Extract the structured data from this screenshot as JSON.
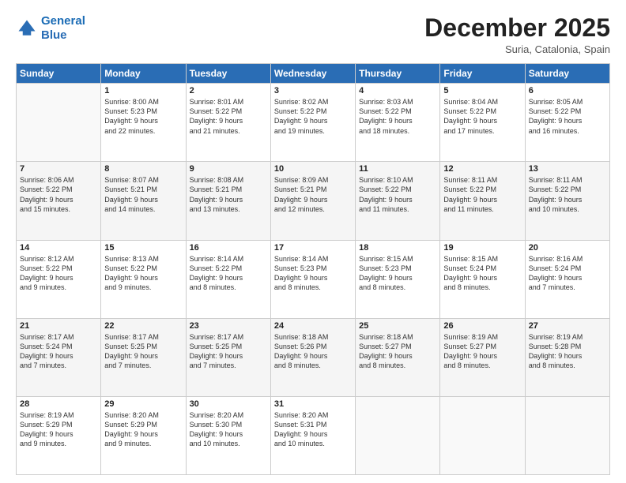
{
  "logo": {
    "line1": "General",
    "line2": "Blue"
  },
  "title": "December 2025",
  "location": "Suria, Catalonia, Spain",
  "weekdays": [
    "Sunday",
    "Monday",
    "Tuesday",
    "Wednesday",
    "Thursday",
    "Friday",
    "Saturday"
  ],
  "weeks": [
    [
      {
        "day": "",
        "info": ""
      },
      {
        "day": "1",
        "info": "Sunrise: 8:00 AM\nSunset: 5:23 PM\nDaylight: 9 hours\nand 22 minutes."
      },
      {
        "day": "2",
        "info": "Sunrise: 8:01 AM\nSunset: 5:22 PM\nDaylight: 9 hours\nand 21 minutes."
      },
      {
        "day": "3",
        "info": "Sunrise: 8:02 AM\nSunset: 5:22 PM\nDaylight: 9 hours\nand 19 minutes."
      },
      {
        "day": "4",
        "info": "Sunrise: 8:03 AM\nSunset: 5:22 PM\nDaylight: 9 hours\nand 18 minutes."
      },
      {
        "day": "5",
        "info": "Sunrise: 8:04 AM\nSunset: 5:22 PM\nDaylight: 9 hours\nand 17 minutes."
      },
      {
        "day": "6",
        "info": "Sunrise: 8:05 AM\nSunset: 5:22 PM\nDaylight: 9 hours\nand 16 minutes."
      }
    ],
    [
      {
        "day": "7",
        "info": "Sunrise: 8:06 AM\nSunset: 5:22 PM\nDaylight: 9 hours\nand 15 minutes."
      },
      {
        "day": "8",
        "info": "Sunrise: 8:07 AM\nSunset: 5:21 PM\nDaylight: 9 hours\nand 14 minutes."
      },
      {
        "day": "9",
        "info": "Sunrise: 8:08 AM\nSunset: 5:21 PM\nDaylight: 9 hours\nand 13 minutes."
      },
      {
        "day": "10",
        "info": "Sunrise: 8:09 AM\nSunset: 5:21 PM\nDaylight: 9 hours\nand 12 minutes."
      },
      {
        "day": "11",
        "info": "Sunrise: 8:10 AM\nSunset: 5:22 PM\nDaylight: 9 hours\nand 11 minutes."
      },
      {
        "day": "12",
        "info": "Sunrise: 8:11 AM\nSunset: 5:22 PM\nDaylight: 9 hours\nand 11 minutes."
      },
      {
        "day": "13",
        "info": "Sunrise: 8:11 AM\nSunset: 5:22 PM\nDaylight: 9 hours\nand 10 minutes."
      }
    ],
    [
      {
        "day": "14",
        "info": "Sunrise: 8:12 AM\nSunset: 5:22 PM\nDaylight: 9 hours\nand 9 minutes."
      },
      {
        "day": "15",
        "info": "Sunrise: 8:13 AM\nSunset: 5:22 PM\nDaylight: 9 hours\nand 9 minutes."
      },
      {
        "day": "16",
        "info": "Sunrise: 8:14 AM\nSunset: 5:22 PM\nDaylight: 9 hours\nand 8 minutes."
      },
      {
        "day": "17",
        "info": "Sunrise: 8:14 AM\nSunset: 5:23 PM\nDaylight: 9 hours\nand 8 minutes."
      },
      {
        "day": "18",
        "info": "Sunrise: 8:15 AM\nSunset: 5:23 PM\nDaylight: 9 hours\nand 8 minutes."
      },
      {
        "day": "19",
        "info": "Sunrise: 8:15 AM\nSunset: 5:24 PM\nDaylight: 9 hours\nand 8 minutes."
      },
      {
        "day": "20",
        "info": "Sunrise: 8:16 AM\nSunset: 5:24 PM\nDaylight: 9 hours\nand 7 minutes."
      }
    ],
    [
      {
        "day": "21",
        "info": "Sunrise: 8:17 AM\nSunset: 5:24 PM\nDaylight: 9 hours\nand 7 minutes."
      },
      {
        "day": "22",
        "info": "Sunrise: 8:17 AM\nSunset: 5:25 PM\nDaylight: 9 hours\nand 7 minutes."
      },
      {
        "day": "23",
        "info": "Sunrise: 8:17 AM\nSunset: 5:25 PM\nDaylight: 9 hours\nand 7 minutes."
      },
      {
        "day": "24",
        "info": "Sunrise: 8:18 AM\nSunset: 5:26 PM\nDaylight: 9 hours\nand 8 minutes."
      },
      {
        "day": "25",
        "info": "Sunrise: 8:18 AM\nSunset: 5:27 PM\nDaylight: 9 hours\nand 8 minutes."
      },
      {
        "day": "26",
        "info": "Sunrise: 8:19 AM\nSunset: 5:27 PM\nDaylight: 9 hours\nand 8 minutes."
      },
      {
        "day": "27",
        "info": "Sunrise: 8:19 AM\nSunset: 5:28 PM\nDaylight: 9 hours\nand 8 minutes."
      }
    ],
    [
      {
        "day": "28",
        "info": "Sunrise: 8:19 AM\nSunset: 5:29 PM\nDaylight: 9 hours\nand 9 minutes."
      },
      {
        "day": "29",
        "info": "Sunrise: 8:20 AM\nSunset: 5:29 PM\nDaylight: 9 hours\nand 9 minutes."
      },
      {
        "day": "30",
        "info": "Sunrise: 8:20 AM\nSunset: 5:30 PM\nDaylight: 9 hours\nand 10 minutes."
      },
      {
        "day": "31",
        "info": "Sunrise: 8:20 AM\nSunset: 5:31 PM\nDaylight: 9 hours\nand 10 minutes."
      },
      {
        "day": "",
        "info": ""
      },
      {
        "day": "",
        "info": ""
      },
      {
        "day": "",
        "info": ""
      }
    ]
  ]
}
